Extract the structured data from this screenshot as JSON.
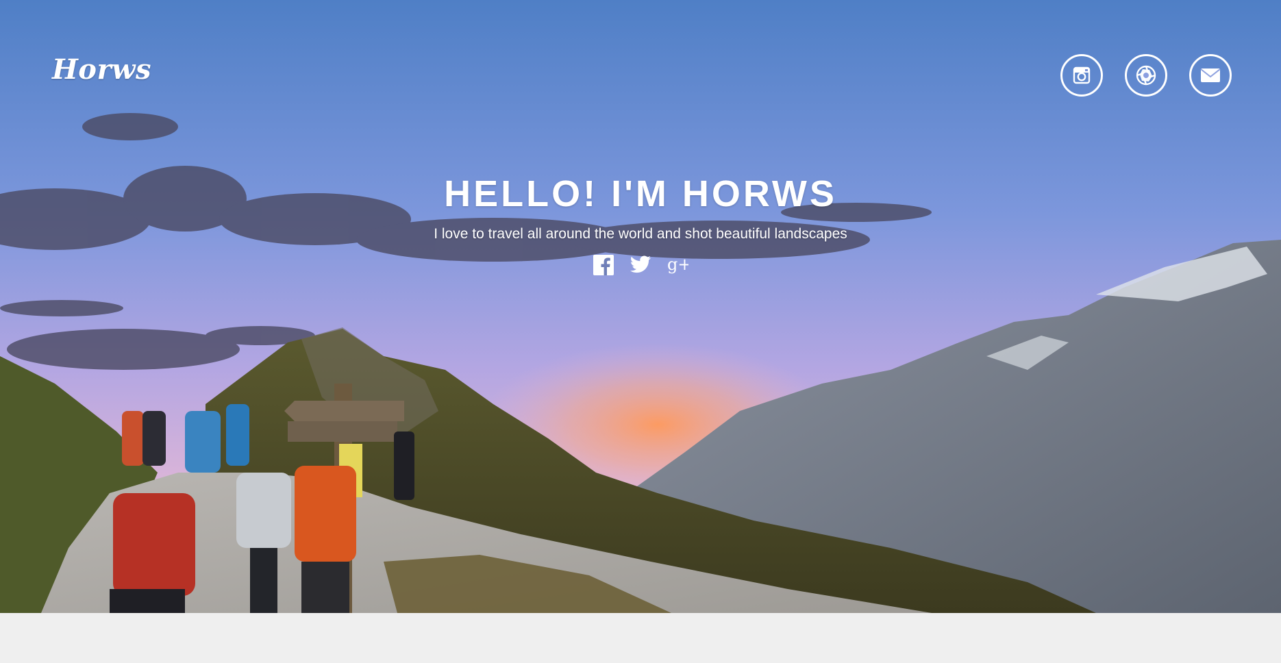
{
  "brand": {
    "logo_text": "Horws"
  },
  "header": {
    "icons": [
      {
        "name": "instagram-icon"
      },
      {
        "name": "aperture-icon"
      },
      {
        "name": "mail-icon"
      }
    ]
  },
  "hero": {
    "title": "HELLO! I'M HORWS",
    "subtitle": "I love to travel all around the world and shot beautiful landscapes",
    "social": [
      {
        "name": "facebook-icon"
      },
      {
        "name": "twitter-icon"
      },
      {
        "name": "google-plus-icon",
        "label": "g+"
      }
    ]
  },
  "colors": {
    "text": "#ffffff",
    "footer_bg": "#efefef",
    "sky_top": "#5b86c9",
    "sky_mid": "#a9a3e0",
    "sunset": "#f39a6a"
  }
}
